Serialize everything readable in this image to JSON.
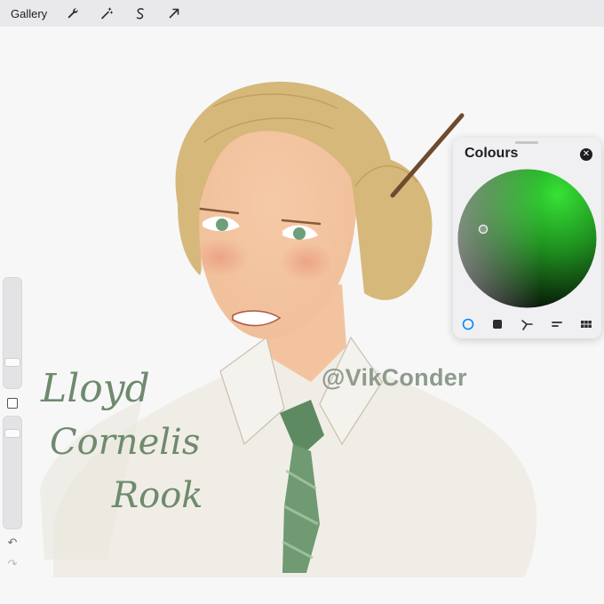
{
  "toolbar": {
    "gallery_label": "Gallery",
    "tools": [
      "wrench-icon",
      "magic-wand-icon",
      "selection-icon",
      "transform-arrow-icon"
    ]
  },
  "canvas": {
    "watermark": "@VikConder",
    "signature": {
      "line1": "Lloyd",
      "line2": "Cornelis",
      "line3": "Rook"
    }
  },
  "colour_panel": {
    "title": "Colours",
    "accent": "#2ecc2e",
    "tabs": [
      "disc-tab",
      "classic-tab",
      "harmony-tab",
      "value-tab",
      "palettes-tab"
    ],
    "active_tab": "disc-tab"
  },
  "colors": {
    "toolbar_bg": "#e9e9eb",
    "active_blue": "#0a84ff"
  }
}
